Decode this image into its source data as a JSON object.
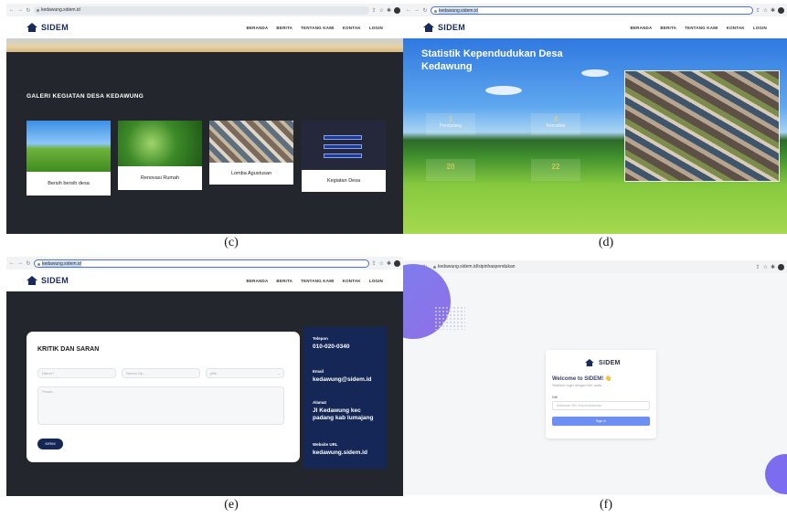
{
  "panels": {
    "c": {
      "caption": "(c)",
      "url": "kedawung.sidem.id",
      "brand": "SIDEM",
      "menu": [
        "BERANDA",
        "BERITA",
        "TENTANG KAMI",
        "KONTAK",
        "LOGIN"
      ],
      "gallery_title": "GALERI KEGIATAN DESA KEDAWUNG",
      "cards": [
        {
          "label": "Bersih bersih desa"
        },
        {
          "label": "Renovasi Rumah"
        },
        {
          "label": "Lomba Agustusan"
        },
        {
          "label": "Kegiatan Desa"
        }
      ]
    },
    "d": {
      "caption": "(d)",
      "url": "kedawung.sidem.id",
      "brand": "SIDEM",
      "menu": [
        "BERANDA",
        "BERITA",
        "TENTANG KAMI",
        "KONTAK",
        "LOGIN"
      ],
      "hero_title": "Statistik Kependudukan Desa Kedawung",
      "stats": [
        {
          "value": "1",
          "label": "Pendatang"
        },
        {
          "value": "4",
          "label": "Kematian"
        },
        {
          "value": "20",
          "label": ""
        },
        {
          "value": "22",
          "label": ""
        }
      ]
    },
    "e": {
      "caption": "(e)",
      "url": "kedawung.sidem.id",
      "brand": "SIDEM",
      "menu": [
        "BERANDA",
        "BERITA",
        "TENTANG KAMI",
        "KONTAK",
        "LOGIN"
      ],
      "form_title": "KRITIK DAN SARAN",
      "fields": {
        "name_placeholder": "Nama *",
        "phone_placeholder": "Nomor Hp...",
        "select_value": "pilih",
        "message_placeholder": "Pesan..."
      },
      "submit_label": "KIRIM",
      "contact": {
        "phone_label": "Telepon",
        "phone_value": "010-020-0340",
        "email_label": "Email",
        "email_value": "kedawung@sidem.id",
        "address_label": "Alamat",
        "address_value": "Jl Kedawung kec padang kab lumajang",
        "website_label": "Website URL",
        "website_value": "kedawung.sidem.id"
      }
    },
    "f": {
      "caption": "(f)",
      "url": "kedawung.sidem.id/sipinhaspendukan",
      "brand": "SIDEM",
      "welcome": "Welcome to SIDEM! 👋",
      "subtitle": "Silahkan login dengan NIK anda",
      "nik_label": "NIK",
      "nik_placeholder": "Masukan NIK Kependudukan",
      "signin_label": "Sign in"
    }
  },
  "colors": {
    "brand_navy": "#1a2a5c",
    "dark_bg": "#23262c",
    "info_card": "#142757",
    "login_button": "#6d8ef2",
    "blob": "#7b7ff0"
  }
}
